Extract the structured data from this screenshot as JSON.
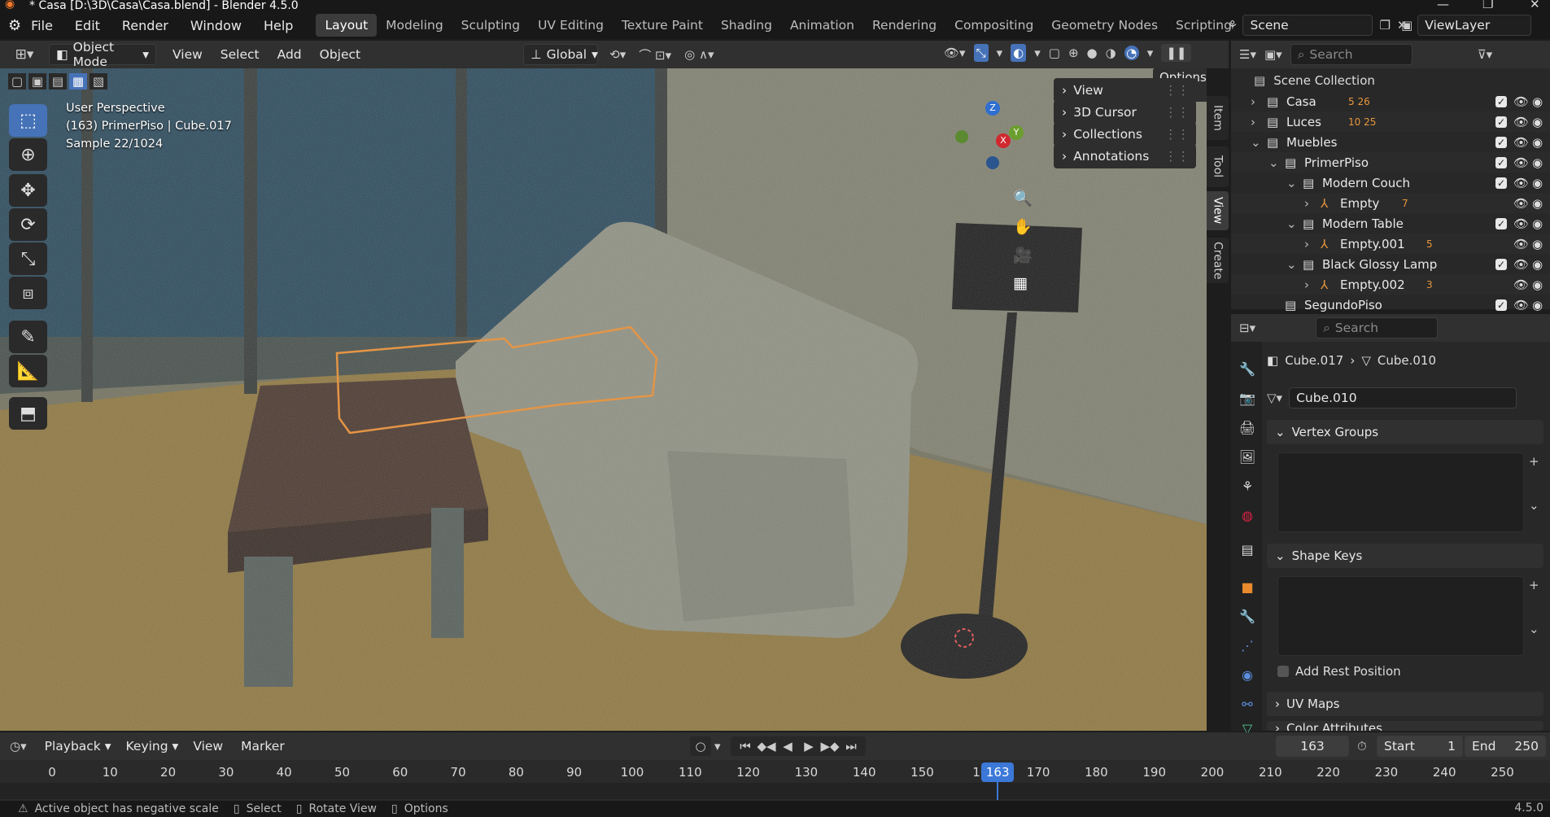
{
  "window": {
    "title": "* Casa [D:\\3D\\Casa\\Casa.blend] - Blender 4.5.0"
  },
  "menu": {
    "file": "File",
    "edit": "Edit",
    "render": "Render",
    "window": "Window",
    "help": "Help"
  },
  "workspaces": [
    "Layout",
    "Modeling",
    "Sculpting",
    "UV Editing",
    "Texture Paint",
    "Shading",
    "Animation",
    "Rendering",
    "Compositing",
    "Geometry Nodes",
    "Scripting"
  ],
  "active_workspace": "Layout",
  "scene": {
    "name": "Scene",
    "view_layer": "ViewLayer"
  },
  "viewport_header": {
    "mode": "Object Mode",
    "view": "View",
    "select": "Select",
    "add": "Add",
    "object": "Object",
    "orientation": "Global",
    "options": "Options"
  },
  "viewport": {
    "perspective": "User Perspective",
    "object_info": "(163) PrimerPiso | Cube.017",
    "sample": "Sample 22/1024"
  },
  "npanel": {
    "items": [
      "View",
      "3D Cursor",
      "Collections",
      "Annotations"
    ],
    "tabs": [
      "Item",
      "Tool",
      "View",
      "Create"
    ]
  },
  "gizmo": {
    "z": "Z",
    "y": "Y",
    "x": "X"
  },
  "outliner": {
    "search_placeholder": "Search",
    "root": "Scene Collection",
    "rows": [
      {
        "name": "Casa",
        "badge": "5  26"
      },
      {
        "name": "Luces",
        "badge": "10  25"
      },
      {
        "name": "Muebles",
        "badge": ""
      },
      {
        "name": "PrimerPiso",
        "badge": ""
      },
      {
        "name": "Modern Couch",
        "badge": ""
      },
      {
        "name": "Empty",
        "badge": "7"
      },
      {
        "name": "Modern Table",
        "badge": ""
      },
      {
        "name": "Empty.001",
        "badge": "5"
      },
      {
        "name": "Black Glossy Lamp",
        "badge": ""
      },
      {
        "name": "Empty.002",
        "badge": "3"
      },
      {
        "name": "SegundoPiso",
        "badge": ""
      }
    ]
  },
  "properties": {
    "search_placeholder": "Search",
    "breadcrumb_object": "Cube.017",
    "breadcrumb_data": "Cube.010",
    "mesh_name": "Cube.010",
    "sections": [
      "Vertex Groups",
      "Shape Keys",
      "UV Maps",
      "Color Attributes"
    ],
    "add_rest_position": "Add Rest Position"
  },
  "timeline": {
    "playback": "Playback",
    "keying": "Keying",
    "view": "View",
    "marker": "Marker",
    "current_frame": "163",
    "start_label": "Start",
    "start": "1",
    "end_label": "End",
    "end": "250",
    "ticks": [
      "0",
      "10",
      "20",
      "30",
      "40",
      "50",
      "60",
      "70",
      "80",
      "90",
      "100",
      "110",
      "120",
      "130",
      "140",
      "150",
      "16",
      "170",
      "180",
      "190",
      "200",
      "210",
      "220",
      "230",
      "240",
      "250"
    ]
  },
  "status": {
    "warning": "Active object has negative scale",
    "select": "Select",
    "rotate": "Rotate View",
    "options": "Options",
    "version": "4.5.0"
  },
  "colors": {
    "accent": "#4672b8",
    "selection_outline": "#f08a24",
    "frame_marker": "#3b78d8"
  }
}
